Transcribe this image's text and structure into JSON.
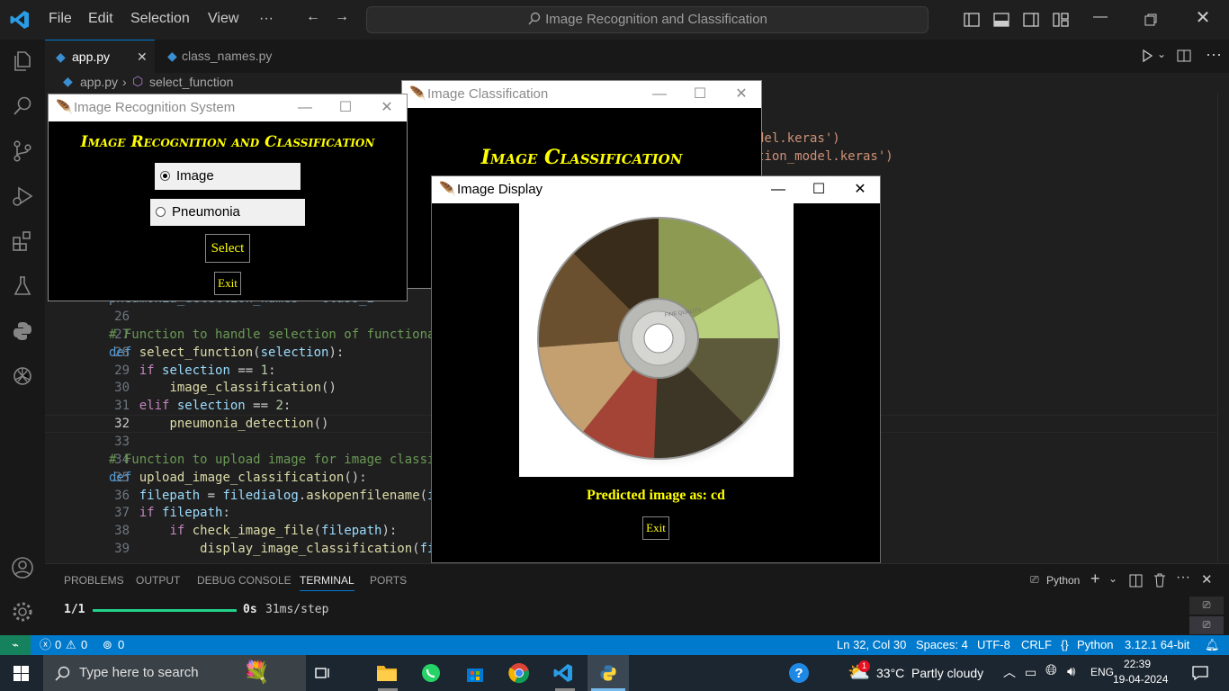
{
  "titlebar": {
    "menu": [
      "File",
      "Edit",
      "Selection",
      "View",
      "···"
    ],
    "search_text": "Image Recognition and Classification"
  },
  "tabs": [
    {
      "label": "app.py",
      "active": true
    },
    {
      "label": "class_names.py",
      "active": false
    }
  ],
  "breadcrumb": {
    "file": "app.py",
    "symbol": "select_function"
  },
  "editor": {
    "partial_lines": [
      {
        "text": "del.keras')"
      },
      {
        "text": "tion_model.keras')"
      },
      {
        "text": "pneumonia_detection_names = class_2"
      }
    ],
    "lines": [
      {
        "num": "26",
        "text": ""
      },
      {
        "num": "27",
        "text": "# Function to handle selection of functionali"
      },
      {
        "num": "28",
        "text": "def select_function(selection):"
      },
      {
        "num": "29",
        "text": "    if selection == 1:"
      },
      {
        "num": "30",
        "text": "        image_classification()"
      },
      {
        "num": "31",
        "text": "    elif selection == 2:"
      },
      {
        "num": "32",
        "text": "        pneumonia_detection()"
      },
      {
        "num": "33",
        "text": ""
      },
      {
        "num": "34",
        "text": "# Function to upload image for image classifi"
      },
      {
        "num": "35",
        "text": "def upload_image_classification():"
      },
      {
        "num": "36",
        "text": "    filepath = filedialog.askopenfilename(ini"
      },
      {
        "num": "37",
        "text": "    if filepath:"
      },
      {
        "num": "38",
        "text": "        if check_image_file(filepath):"
      },
      {
        "num": "39",
        "text": "            display_image_classification(file"
      }
    ]
  },
  "panel": {
    "tabs": [
      "PROBLEMS",
      "OUTPUT",
      "DEBUG CONSOLE",
      "TERMINAL",
      "PORTS"
    ],
    "active_tab": "TERMINAL",
    "terminal_label": "Python",
    "progress_count": "1/1",
    "progress_fraction": 1.0,
    "progress_time": "0s",
    "progress_step": "31ms/step"
  },
  "statusbar": {
    "errors": "0",
    "warnings": "0",
    "ports": "0",
    "position": "Ln 32, Col 30",
    "spaces": "Spaces: 4",
    "encoding": "UTF-8",
    "eol": "CRLF",
    "language": "Python",
    "interpreter": "3.12.1 64-bit"
  },
  "taskbar": {
    "search_placeholder": "Type here to search",
    "weather_temp": "33°C",
    "weather_desc": "Partly cloudy",
    "weather_badge": "1",
    "language": "ENG",
    "time": "22:39",
    "date": "19-04-2024"
  },
  "win_recognition": {
    "title": "Image Recognition System",
    "heading": "Image Recognition and Classification",
    "option1": "Image Classification",
    "option2": "Pneumonia Detection",
    "select_label": "Select",
    "exit_label": "Exit"
  },
  "win_classification": {
    "title": "Image Classification",
    "heading": "Image Classification"
  },
  "win_display": {
    "title": "Image Display",
    "prediction": "Predicted image as: cd",
    "exit_label": "Exit",
    "disc_label": "FINE QUALITY"
  },
  "colors": {
    "accent": "#007acc",
    "tk_text": "#ffff00",
    "progress": "#23d18b"
  }
}
